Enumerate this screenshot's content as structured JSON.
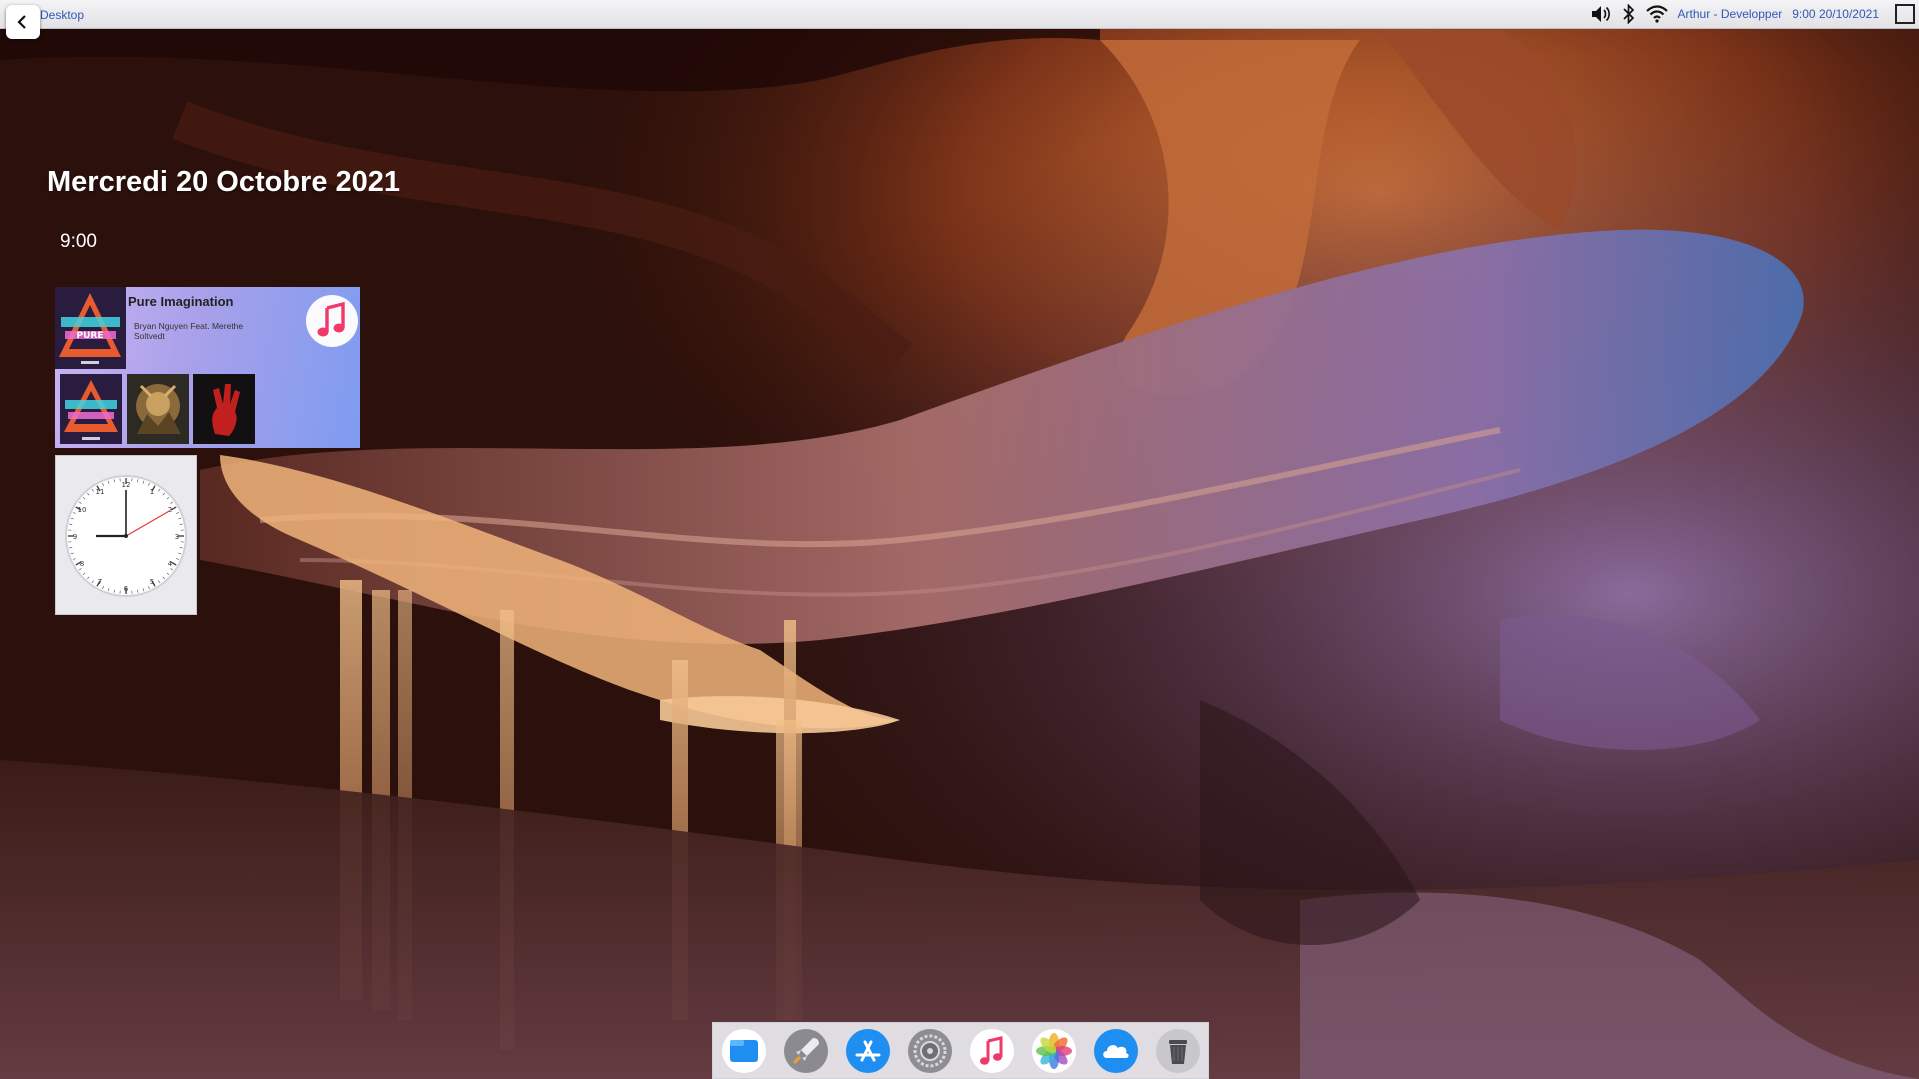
{
  "menubar": {
    "title": "Desktop",
    "user_label": "Arthur - Developper",
    "clock_label": "9:00 20/10/2021"
  },
  "desktop": {
    "date": "Mercredi 20 Octobre 2021",
    "time": "9:00"
  },
  "music_widget": {
    "track_title": "Pure Imagination",
    "track_artist": "Bryan Nguyen Feat. Merethe Soltvedt",
    "album_main_text": "PURE Imagination"
  },
  "clock": {
    "hour": 9,
    "minute": 0,
    "second": 5
  },
  "dock": {
    "items": [
      {
        "name": "finder-icon"
      },
      {
        "name": "launchpad-icon"
      },
      {
        "name": "app-store-icon"
      },
      {
        "name": "system-preferences-icon"
      },
      {
        "name": "music-icon"
      },
      {
        "name": "photos-icon"
      },
      {
        "name": "icloud-icon"
      },
      {
        "name": "trash-icon"
      }
    ]
  },
  "colors": {
    "menubar_text": "#2f57b8",
    "music_widget_start": "#c9b3f4",
    "music_widget_end": "#7e9cf0",
    "clock_second_hand": "#e53935"
  }
}
